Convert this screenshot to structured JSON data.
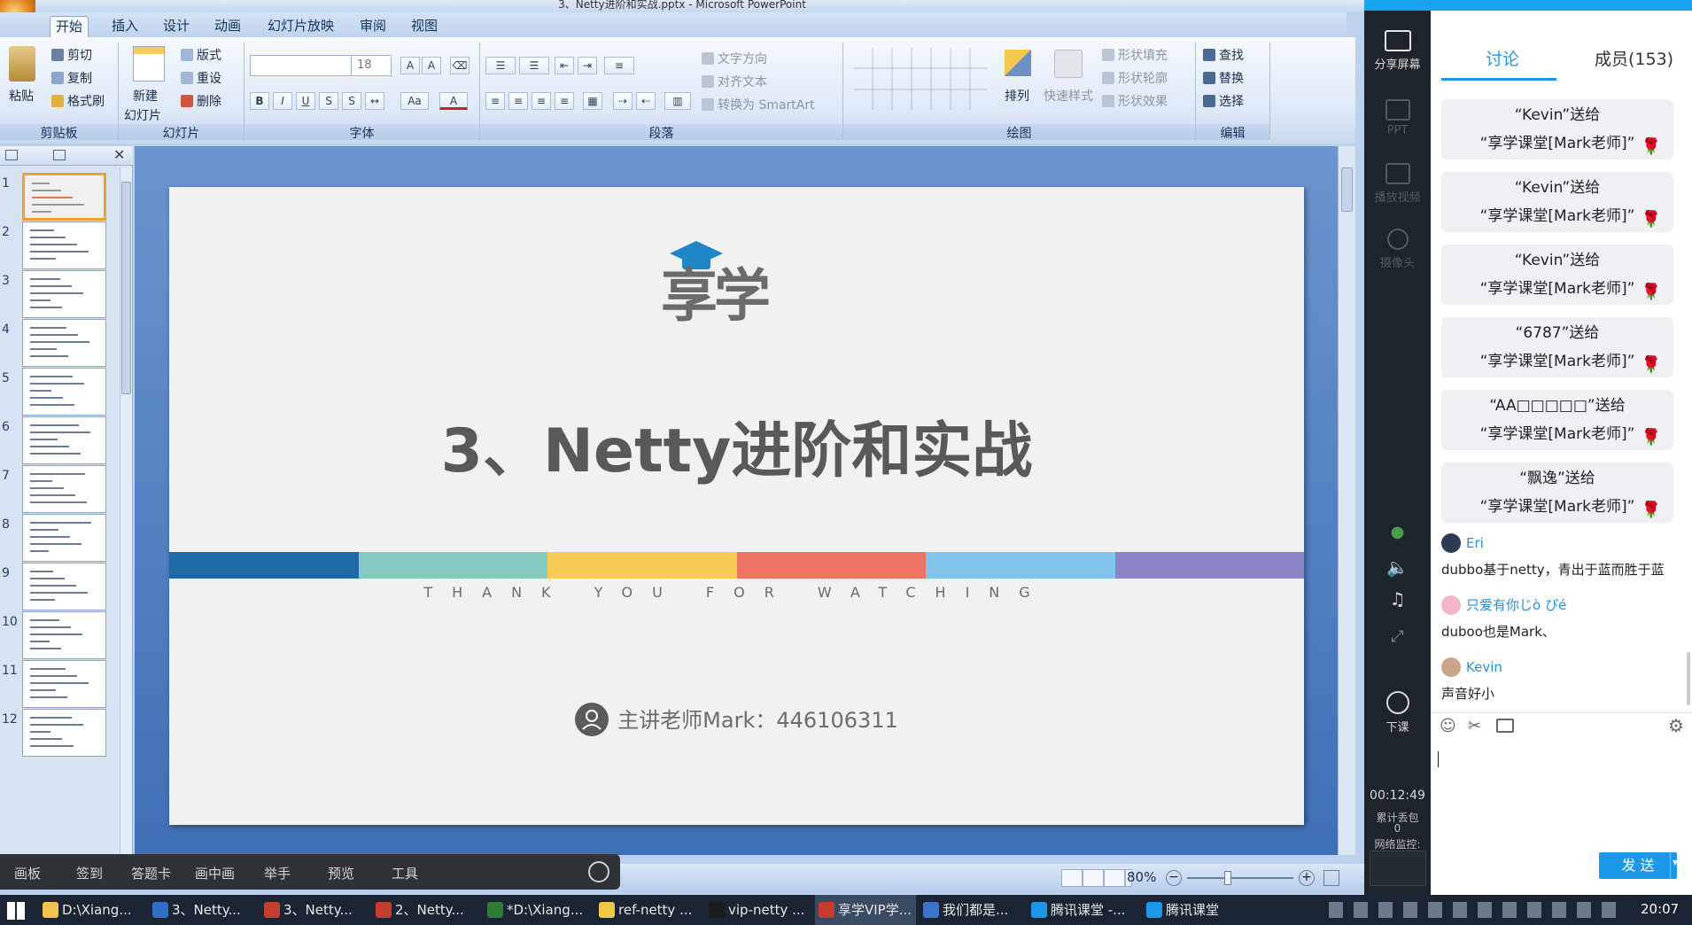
{
  "window": {
    "title": "3、Netty进阶和实战.pptx - Microsoft PowerPoint"
  },
  "ribbon_tabs": [
    "开始",
    "插入",
    "设计",
    "动画",
    "幻灯片放映",
    "审阅",
    "视图"
  ],
  "clipboard": {
    "paste": "粘贴",
    "cut": "剪切",
    "copy": "复制",
    "format_painter": "格式刷",
    "label": "剪贴板"
  },
  "slides_group": {
    "new_slide": "新建",
    "new_slide2": "幻灯片",
    "layout": "版式",
    "reset": "重设",
    "delete": "删除",
    "label": "幻灯片"
  },
  "font_group": {
    "font_size": "18",
    "label": "字体"
  },
  "paragraph_group": {
    "text_direction": "文字方向",
    "align_text": "对齐文本",
    "smartart": "转换为 SmartArt",
    "label": "段落"
  },
  "drawing_group": {
    "arrange": "排列",
    "quick_styles": "快速样式",
    "shape_fill": "形状填充",
    "shape_outline": "形状轮廓",
    "shape_effects": "形状效果",
    "label": "绘图"
  },
  "editing_group": {
    "find": "查找",
    "replace": "替换",
    "select": "选择",
    "label": "编辑"
  },
  "slide_numbers": [
    "1",
    "2",
    "3",
    "4",
    "5",
    "6",
    "7",
    "8",
    "9",
    "10",
    "11",
    "12"
  ],
  "slide": {
    "logo_text": "享学",
    "title": "3、Netty进阶和实战",
    "thanks": "THANK YOU FOR WATCHING",
    "presenter": "主讲老师Mark：446106311",
    "bar_colors": [
      "#1f6aa5",
      "#86c9c0",
      "#f7cc54",
      "#ee7466",
      "#82c3ea",
      "#8b85c7"
    ]
  },
  "status": {
    "zoom": "80%"
  },
  "float_toolbar": [
    "画板",
    "签到",
    "答题卡",
    "画中画",
    "举手",
    "预览",
    "工具"
  ],
  "live_panel": {
    "share_screen": "分享屏幕",
    "ppt": "PPT",
    "play_video": "播放视频",
    "camera": "摄像头",
    "end_class": "下课",
    "timer": "00:12:49",
    "packet_loss_label": "累计丢包",
    "packet_loss_value": "0",
    "network_monitor": "网络监控:"
  },
  "chat": {
    "tab_discuss": "讨论",
    "tab_members": "成员(153)",
    "gifts": [
      {
        "line1": "“Kevin”送给",
        "line2": "“享学课堂[Mark老师]”"
      },
      {
        "line1": "“Kevin”送给",
        "line2": "“享学课堂[Mark老师]”"
      },
      {
        "line1": "“Kevin”送给",
        "line2": "“享学课堂[Mark老师]”"
      },
      {
        "line1": "“6787”送给",
        "line2": "“享学课堂[Mark老师]”"
      },
      {
        "line1": "“AA□□□□□”送给",
        "line2": "“享学课堂[Mark老师]”"
      },
      {
        "line1": "“飘逸”送给",
        "line2": "“享学课堂[Mark老师]”"
      }
    ],
    "messages": [
      {
        "user": "Eri",
        "text": "dubbo基于netty，青出于蓝而胜于蓝"
      },
      {
        "user": "只爱有你じò ぴé",
        "text": "duboo也是Mark、"
      },
      {
        "user": "Kevin",
        "text": "声音好小"
      }
    ],
    "send": "发 送"
  },
  "taskbar": {
    "items": [
      "D:\\Xiang...",
      "3、Netty...",
      "3、Netty...",
      "2、Netty...",
      "*D:\\Xiang...",
      "ref-netty ...",
      "vip-netty ...",
      "享学VIP学...",
      "我们都是...",
      "腾讯课堂 -...",
      "腾讯课堂"
    ],
    "clock": "20:07"
  }
}
